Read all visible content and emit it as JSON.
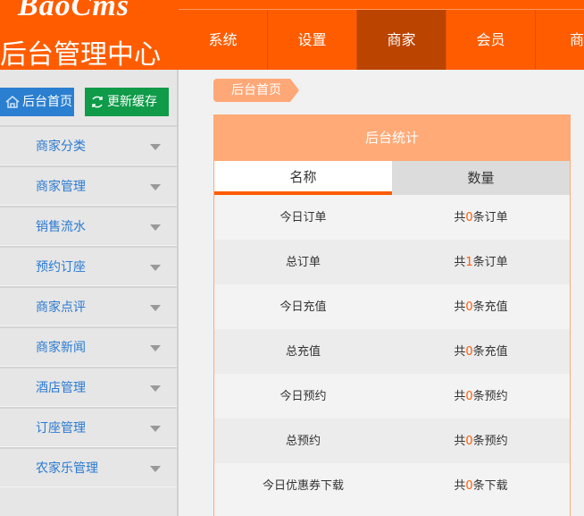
{
  "header": {
    "logo": "BaoCms",
    "title": "后台管理中心",
    "nav": [
      "系统",
      "设置",
      "商家",
      "会员",
      "商"
    ],
    "active_nav": "商家",
    "colors": {
      "primary": "#ff5c00",
      "active": "#bb4400"
    }
  },
  "sidebar": {
    "home_button": "后台首页",
    "cache_button": "更新缓存",
    "items": [
      "商家分类",
      "商家管理",
      "销售流水",
      "预约订座",
      "商家点评",
      "商家新闻",
      "酒店管理",
      "订座管理",
      "农家乐管理"
    ]
  },
  "breadcrumb": "后台首页",
  "stats": {
    "title": "后台统计",
    "columns": [
      "名称",
      "数量"
    ],
    "rows": [
      {
        "name": "今日订单",
        "prefix": "共",
        "count": "0",
        "suffix": "条订单"
      },
      {
        "name": "总订单",
        "prefix": "共",
        "count": "1",
        "suffix": "条订单"
      },
      {
        "name": "今日充值",
        "prefix": "共",
        "count": "0",
        "suffix": "条充值"
      },
      {
        "name": "总充值",
        "prefix": "共",
        "count": "0",
        "suffix": "条充值"
      },
      {
        "name": "今日预约",
        "prefix": "共",
        "count": "0",
        "suffix": "条预约"
      },
      {
        "name": "总预约",
        "prefix": "共",
        "count": "0",
        "suffix": "条预约"
      },
      {
        "name": "今日优惠券下载",
        "prefix": "共",
        "count": "0",
        "suffix": "条下载"
      }
    ]
  }
}
